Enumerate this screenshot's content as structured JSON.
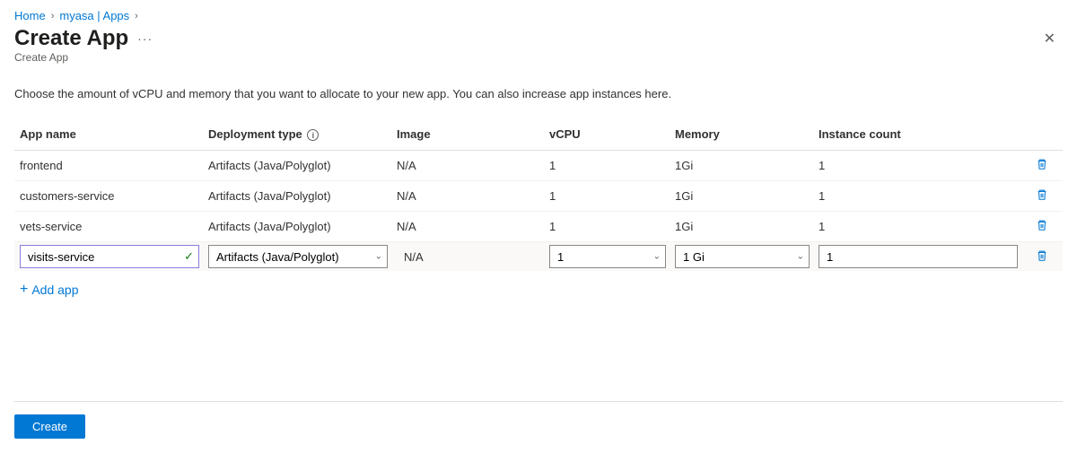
{
  "breadcrumb": {
    "home": "Home",
    "service": "myasa | Apps"
  },
  "title": "Create App",
  "subtitle": "Create App",
  "description": "Choose the amount of vCPU and memory that you want to allocate to your new app. You can also increase app instances here.",
  "columns": {
    "app_name": "App name",
    "deployment_type": "Deployment type",
    "image": "Image",
    "vcpu": "vCPU",
    "memory": "Memory",
    "instance_count": "Instance count"
  },
  "rows": [
    {
      "name": "frontend",
      "deployment_type": "Artifacts (Java/Polyglot)",
      "image": "N/A",
      "vcpu": "1",
      "memory": "1Gi",
      "instances": "1"
    },
    {
      "name": "customers-service",
      "deployment_type": "Artifacts (Java/Polyglot)",
      "image": "N/A",
      "vcpu": "1",
      "memory": "1Gi",
      "instances": "1"
    },
    {
      "name": "vets-service",
      "deployment_type": "Artifacts (Java/Polyglot)",
      "image": "N/A",
      "vcpu": "1",
      "memory": "1Gi",
      "instances": "1"
    }
  ],
  "edit_row": {
    "name": "visits-service",
    "deployment_type": "Artifacts (Java/Polyglot)",
    "image": "N/A",
    "vcpu": "1",
    "memory": "1 Gi",
    "instances": "1"
  },
  "add_app_label": "Add app",
  "create_label": "Create"
}
